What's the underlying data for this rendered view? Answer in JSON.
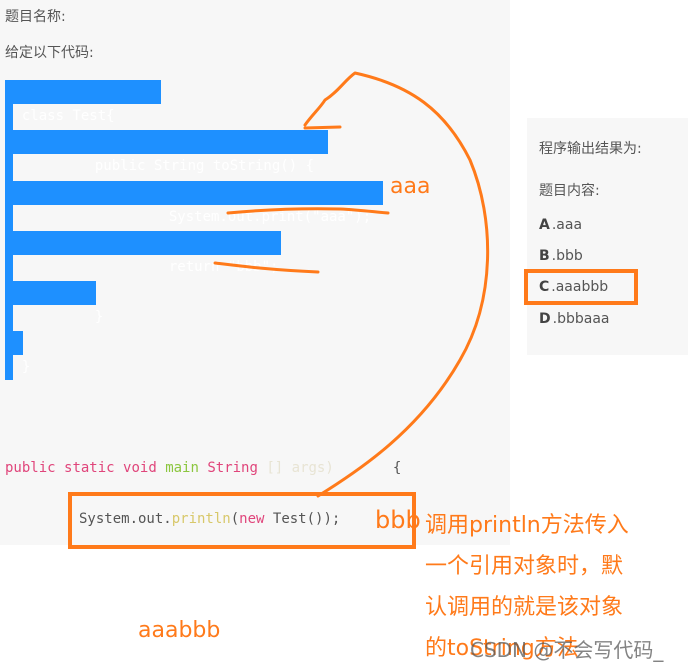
{
  "left": {
    "title_label": "题目名称:",
    "given_label": "给定以下代码:",
    "code": {
      "line1": "class Test{",
      "line2": "public String toString() {",
      "line3": "System.out.print(\"aaa\");",
      "line4": "return \"bbb\";",
      "line5": "}",
      "line6": "}",
      "main_public": "public",
      "main_static": "static",
      "main_void": "void",
      "main_name": "main",
      "main_string": "String",
      "main_args": "[] args)",
      "main_brace": "{",
      "println_prefix": "System.out.",
      "println_fn": "println",
      "println_open": "(",
      "println_new": "new",
      "println_rest": " Test());",
      "close_brace": "}"
    }
  },
  "right": {
    "output_label": "程序输出结果为:",
    "content_label": "题目内容:",
    "options": [
      {
        "letter": "A",
        "text": ".aaa"
      },
      {
        "letter": "B",
        "text": ".bbb"
      },
      {
        "letter": "C",
        "text": ".aaabbb",
        "highlighted": true
      },
      {
        "letter": "D",
        "text": ".bbbaaa"
      }
    ]
  },
  "annotations": {
    "aaa": "aaa",
    "bbb": "bbb",
    "result": "aaabbb",
    "note_lines": [
      "调用println方法传入",
      "一个引用对象时，默",
      "认调用的就是该对象",
      "的toString方法"
    ],
    "color": "#ff7a1a"
  },
  "watermark": "CSDN @不会写代码_",
  "colors": {
    "highlight": "#1e90ff",
    "annotation": "#ff7a1a",
    "panel": "#f7f7f7"
  }
}
